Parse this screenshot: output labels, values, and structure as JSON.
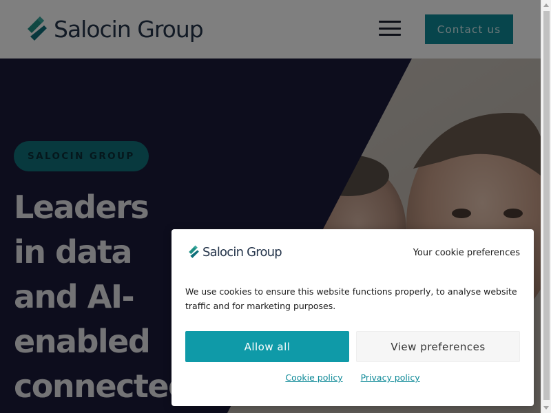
{
  "header": {
    "logo_text": "Salocin Group",
    "menu_icon": "hamburger-menu-icon",
    "contact_label": "Contact us"
  },
  "hero": {
    "tag": "SALOCIN GROUP",
    "title_lines": [
      "Leaders",
      "in data",
      "and AI-",
      "enabled",
      "connected"
    ]
  },
  "cookie": {
    "logo_text": "Salocin Group",
    "title": "Your cookie preferences",
    "body": "We use cookies to ensure this website functions properly, to analyse website traffic and for marketing purposes.",
    "allow_label": "Allow all",
    "prefs_label": "View preferences",
    "cookie_policy_label": "Cookie policy",
    "privacy_policy_label": "Privacy policy"
  },
  "colors": {
    "brand_teal": "#0f8a98",
    "hero_navy": "#1b1a3a",
    "logo_navy": "#24344a"
  }
}
